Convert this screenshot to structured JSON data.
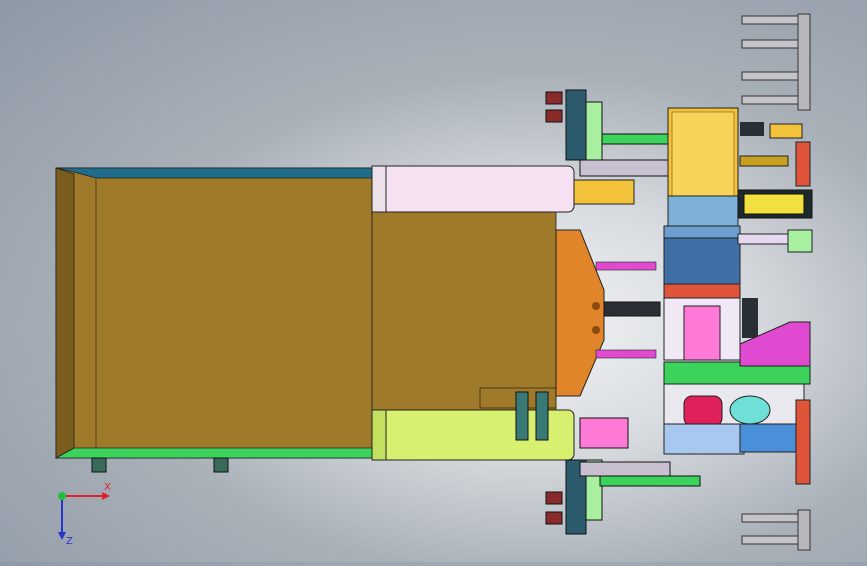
{
  "viewport": {
    "background_top": "#8e99a6",
    "background_center": "#f2f4f6"
  },
  "triad": {
    "x_label": "X",
    "y_label": "Y",
    "z_label": "Z",
    "x_color": "#e0202a",
    "y_color": "#22c03a",
    "z_color": "#2436c8"
  },
  "model": {
    "colors": {
      "hopper_body": "#9e7a2a",
      "hopper_top_edge": "#1f6d8a",
      "hopper_bottom_edge": "#3bd35b",
      "pusher_top": "#f6e1f2",
      "pusher_bottom": "#d8f070",
      "motor": "#f2c23a",
      "coupling_housing": "#3f6fa6",
      "orange_plate": "#e0852a",
      "magenta": "#e04ad0",
      "rail": "#d0509a",
      "pink_block": "#ff7ad6",
      "red_block": "#e0543a",
      "pillar": "#c4c4c8",
      "dark": "#2a2f36",
      "cyan": "#6fe0d8",
      "light_green": "#a8f0a0",
      "lime": "#c8ff40"
    }
  }
}
